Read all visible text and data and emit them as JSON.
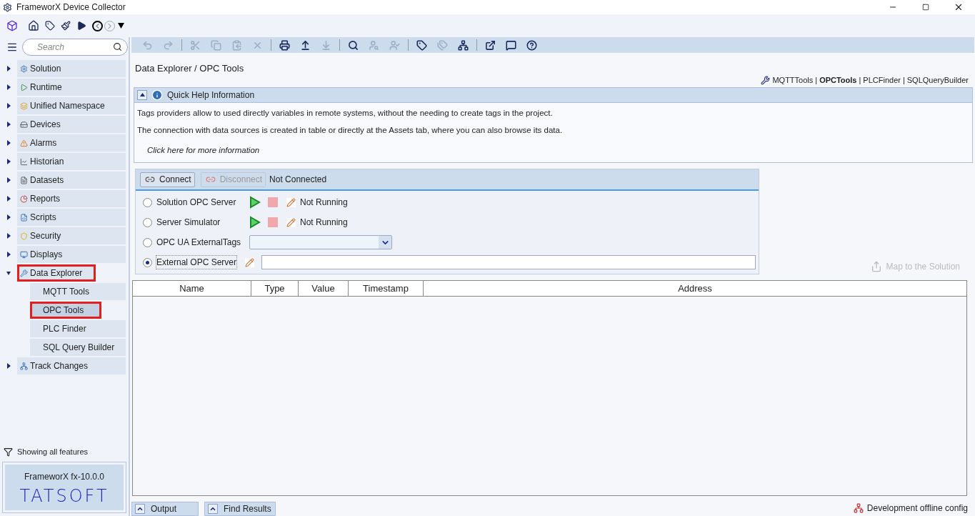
{
  "window": {
    "title": "FrameworX Device Collector"
  },
  "sidebar": {
    "search": {
      "placeholder": "Search"
    },
    "items": [
      {
        "label": "Solution",
        "expanded": false,
        "selected": false,
        "highlighted": false
      },
      {
        "label": "Runtime",
        "expanded": false,
        "selected": false,
        "highlighted": false
      },
      {
        "label": "Unified Namespace",
        "expanded": false,
        "selected": false,
        "highlighted": false
      },
      {
        "label": "Devices",
        "expanded": false,
        "selected": false,
        "highlighted": false
      },
      {
        "label": "Alarms",
        "expanded": false,
        "selected": false,
        "highlighted": false
      },
      {
        "label": "Historian",
        "expanded": false,
        "selected": false,
        "highlighted": false
      },
      {
        "label": "Datasets",
        "expanded": false,
        "selected": false,
        "highlighted": false
      },
      {
        "label": "Reports",
        "expanded": false,
        "selected": false,
        "highlighted": false
      },
      {
        "label": "Scripts",
        "expanded": false,
        "selected": false,
        "highlighted": false
      },
      {
        "label": "Security",
        "expanded": false,
        "selected": false,
        "highlighted": false
      },
      {
        "label": "Displays",
        "expanded": false,
        "selected": false,
        "highlighted": false
      },
      {
        "label": "Data Explorer",
        "expanded": true,
        "selected": false,
        "highlighted": true,
        "children": [
          {
            "label": "MQTT Tools",
            "selected": false,
            "highlighted": false
          },
          {
            "label": "OPC Tools",
            "selected": true,
            "highlighted": true
          },
          {
            "label": "PLC Finder",
            "selected": false,
            "highlighted": false
          },
          {
            "label": "SQL Query Builder",
            "selected": false,
            "highlighted": false
          }
        ]
      },
      {
        "label": "Track Changes",
        "expanded": false,
        "selected": false,
        "highlighted": false
      }
    ],
    "filter": "Showing all features",
    "version": "FrameworX fx-10.0.0",
    "logo": "TATSOFT"
  },
  "toolbar": [
    [
      {
        "disabled": true
      },
      {
        "disabled": true
      }
    ],
    [
      {
        "disabled": true
      },
      {
        "disabled": true
      },
      {
        "disabled": true
      },
      {
        "disabled": true
      }
    ],
    [
      {
        "disabled": false
      },
      {
        "disabled": false
      },
      {
        "disabled": true
      }
    ],
    [
      {
        "disabled": false
      },
      {
        "disabled": true
      },
      {
        "disabled": true
      }
    ],
    [
      {
        "disabled": false
      },
      {
        "disabled": true
      },
      {
        "disabled": false
      }
    ],
    [
      {
        "disabled": false
      },
      {
        "disabled": false
      },
      {
        "disabled": false
      }
    ]
  ],
  "breadcrumb": "Data Explorer / OPC Tools",
  "tool_links": [
    {
      "kind": "link",
      "label": "MQTTTools",
      "selected": false
    },
    {
      "kind": "separator",
      "label": "|"
    },
    {
      "kind": "link",
      "label": "OPCTools",
      "selected": true
    },
    {
      "kind": "separator",
      "label": "|"
    },
    {
      "kind": "link",
      "label": "PLCFinder",
      "selected": false
    },
    {
      "kind": "separator",
      "label": "|"
    },
    {
      "kind": "link",
      "label": "SQLQueryBuilder",
      "selected": false
    }
  ],
  "quick_help": {
    "title": "Quick Help Information",
    "expanded": true,
    "lines": [
      "Tags providers allow to used directly variables in remote systems, without the needing to create tags in the project.",
      "The connection with data sources is created in table or directly at the Assets tab, where you can also browse its data."
    ],
    "link": "Click here for more information"
  },
  "connection": {
    "connect": {
      "label": "Connect",
      "disabled": false
    },
    "disconnect": {
      "label": "Disconnect",
      "disabled": true
    },
    "status": "Not Connected",
    "options": [
      {
        "kind": "server",
        "label": "Solution OPC Server",
        "selected": false,
        "status": "Not Running"
      },
      {
        "kind": "server",
        "label": "Server Simulator",
        "selected": false,
        "status": "Not Running"
      },
      {
        "kind": "dropdown",
        "label": "OPC UA ExternalTags",
        "selected": false
      },
      {
        "kind": "text",
        "label": "External OPC Server",
        "selected": true
      }
    ]
  },
  "map_button": {
    "label": "Map to the Solution",
    "disabled": true
  },
  "table": {
    "columns": [
      "Name",
      "Type",
      "Value",
      "Timestamp",
      "Address"
    ]
  },
  "bottom_tabs": [
    "Output",
    "Find Results"
  ],
  "status_bar": "Development offline config"
}
